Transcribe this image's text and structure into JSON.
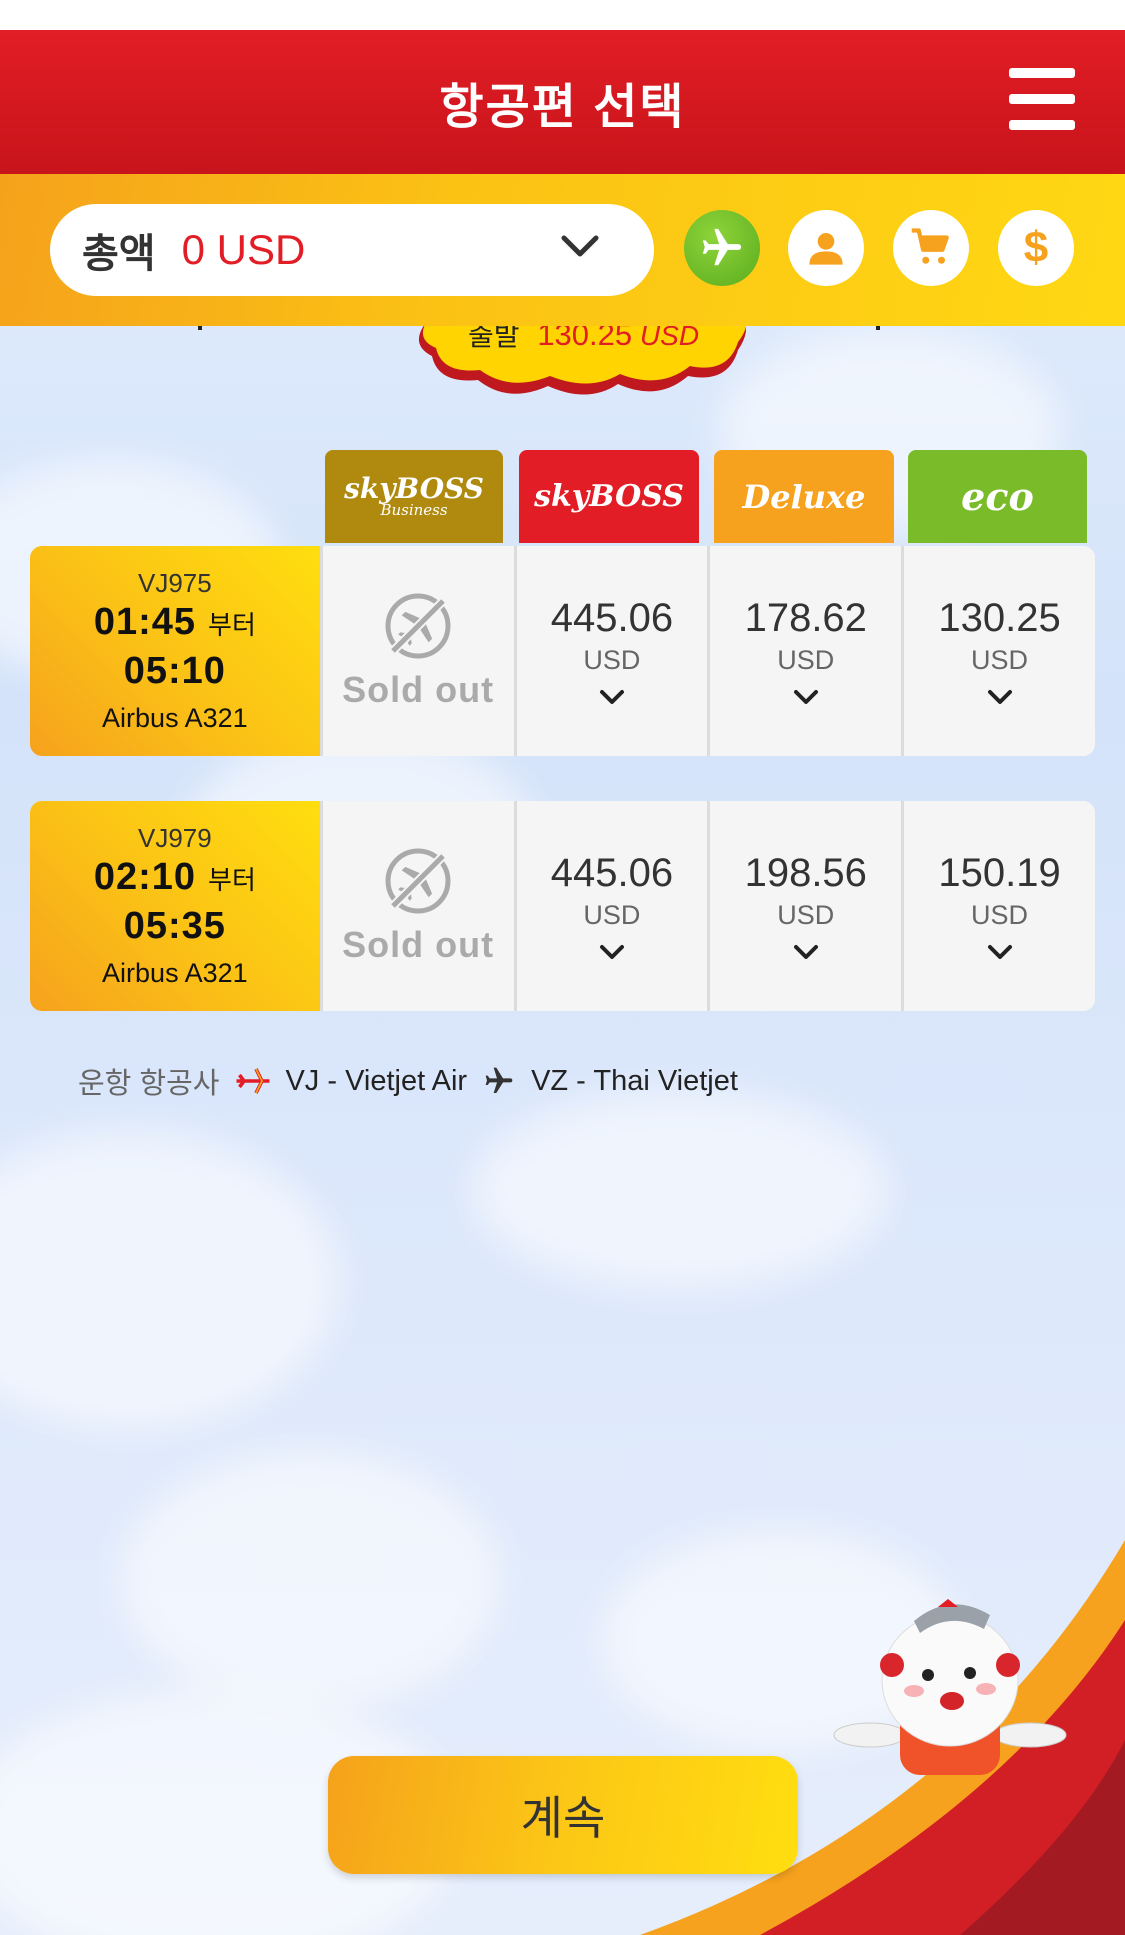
{
  "header": {
    "title": "항공편 선택",
    "menu_icon": "hamburger-menu-icon"
  },
  "summary": {
    "total_label": "총액",
    "total_value": "0 USD",
    "nav_icons": [
      "airplane-icon",
      "user-icon",
      "cart-icon",
      "dollar-icon"
    ]
  },
  "cloud_badge": {
    "label": "출발",
    "amount": "130.25",
    "currency": "USD"
  },
  "fare_classes": [
    {
      "name": "SkyBoss Business",
      "logo_text": "skyBOSS",
      "sub_text": "Business",
      "color": "#b08a0e"
    },
    {
      "name": "SkyBoss",
      "logo_text": "skyBOSS",
      "sub_text": "",
      "color": "#e21d25"
    },
    {
      "name": "Deluxe",
      "logo_text": "Deluxe",
      "sub_text": "",
      "color": "#f7a21e"
    },
    {
      "name": "Eco",
      "logo_text": "eco",
      "sub_text": "",
      "color": "#79bb28"
    }
  ],
  "flights": [
    {
      "flight_no": "VJ975",
      "departure": "01:45",
      "from_label": "부터",
      "arrival": "05:10",
      "aircraft": "Airbus A321",
      "fares": [
        {
          "sold_out": true,
          "label": "Sold out"
        },
        {
          "price": "445.06",
          "currency": "USD"
        },
        {
          "price": "178.62",
          "currency": "USD"
        },
        {
          "price": "130.25",
          "currency": "USD"
        }
      ]
    },
    {
      "flight_no": "VJ979",
      "departure": "02:10",
      "from_label": "부터",
      "arrival": "05:35",
      "aircraft": "Airbus A321",
      "fares": [
        {
          "sold_out": true,
          "label": "Sold out"
        },
        {
          "price": "445.06",
          "currency": "USD"
        },
        {
          "price": "198.56",
          "currency": "USD"
        },
        {
          "price": "150.19",
          "currency": "USD"
        }
      ]
    }
  ],
  "operators": {
    "label": "운항 항공사",
    "items": [
      {
        "text": "VJ - Vietjet Air",
        "icon": "vietjet-plane-icon",
        "color": "#e21d25"
      },
      {
        "text": "VZ - Thai Vietjet",
        "icon": "thai-vietjet-plane-icon",
        "color": "#333333"
      }
    ]
  },
  "continue_button": {
    "label": "계속"
  },
  "colors": {
    "brand_red": "#e21d25",
    "brand_yellow": "#ffd813",
    "accent_green": "#5aac1e"
  }
}
